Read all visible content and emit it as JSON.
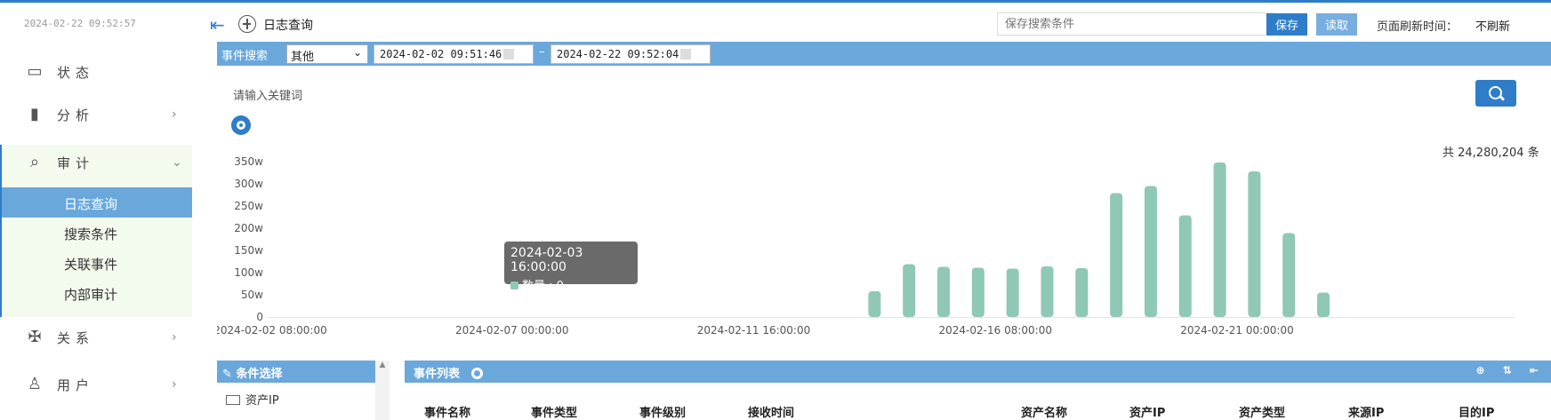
{
  "clock": "2024-02-22 09:52:57",
  "sidebar": {
    "items": [
      {
        "label": "状态",
        "icon": "monitor-icon",
        "glyph": "▭"
      },
      {
        "label": "分析",
        "icon": "bar-chart-icon",
        "glyph": "▮"
      },
      {
        "label": "审计",
        "icon": "audit-icon",
        "glyph": "⌕"
      },
      {
        "label": "关系",
        "icon": "relation-icon",
        "glyph": "✠"
      },
      {
        "label": "用户",
        "icon": "user-icon",
        "glyph": "♙"
      }
    ],
    "audit_sub": [
      "日志查询",
      "搜索条件",
      "关联事件",
      "内部审计"
    ],
    "active_sub": "日志查询"
  },
  "header": {
    "title": "日志查询",
    "save_placeholder": "保存搜索条件",
    "save_label": "保存",
    "read_label": "读取",
    "refresh_label": "页面刷新时间：",
    "refresh_value": "不刷新"
  },
  "search": {
    "label": "事件搜索",
    "type_value": "其他",
    "start": "2024-02-02 09:51:46",
    "end": "2024-02-22 09:52:04",
    "keyword_placeholder": "请输入关键词",
    "total": "共 24,280,204 条"
  },
  "tooltip": {
    "time": "2024-02-03 16:00:00",
    "label": "数量 : 0"
  },
  "colors": {
    "accent": "#2f7dc8",
    "bar": "#8fc8b4",
    "panel": "#6aa8dc"
  },
  "chart_data": {
    "type": "bar",
    "ylabels": [
      "350w",
      "300w",
      "250w",
      "200w",
      "150w",
      "100w",
      "50w",
      "0"
    ],
    "ylim": [
      0,
      350
    ],
    "unit": "w",
    "xlabels": [
      "2024-02-02 08:00:00",
      "2024-02-07 00:00:00",
      "2024-02-11 16:00:00",
      "2024-02-16 08:00:00",
      "2024-02-21 00:00:00"
    ],
    "x": [
      "2024-02-14 00:00",
      "2024-02-14 16:00",
      "2024-02-15 08:00",
      "2024-02-16 00:00",
      "2024-02-16 16:00",
      "2024-02-17 08:00",
      "2024-02-18 00:00",
      "2024-02-18 16:00",
      "2024-02-19 08:00",
      "2024-02-20 00:00",
      "2024-02-20 16:00",
      "2024-02-21 08:00",
      "2024-02-22 00:00",
      "2024-02-22 16:00"
    ],
    "values": [
      58,
      119,
      113,
      111,
      109,
      114,
      110,
      279,
      295,
      229,
      348,
      328,
      189,
      55
    ]
  },
  "panels": {
    "cond_title": "条件选择",
    "cond_item": "资产IP",
    "event_title": "事件列表",
    "event_tools": "⊕ ⇅ ⇤",
    "columns": [
      "事件名称",
      "事件类型",
      "事件级别",
      "接收时间",
      "资产名称",
      "资产IP",
      "资产类型",
      "来源IP",
      "目的IP"
    ]
  }
}
